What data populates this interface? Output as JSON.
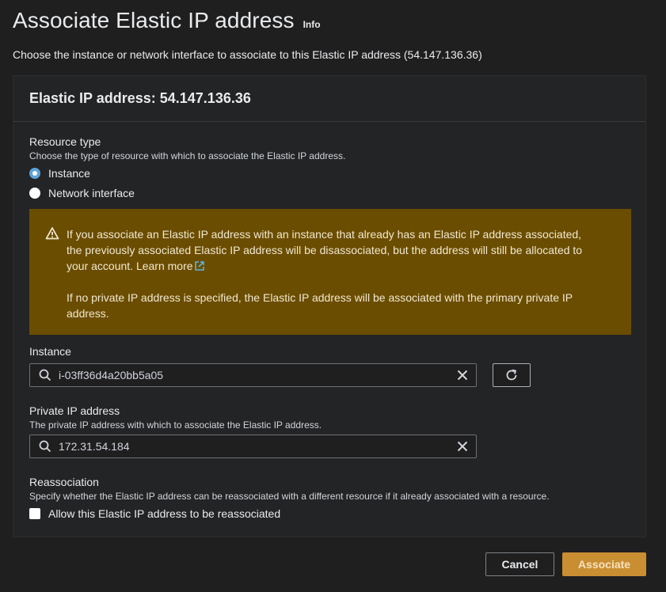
{
  "header": {
    "title": "Associate Elastic IP address",
    "info_label": "Info",
    "description": "Choose the instance or network interface to associate to this Elastic IP address (54.147.136.36)"
  },
  "panel": {
    "title": "Elastic IP address: 54.147.136.36"
  },
  "resource_type": {
    "label": "Resource type",
    "description": "Choose the type of resource with which to associate the Elastic IP address.",
    "options": [
      {
        "label": "Instance",
        "selected": true
      },
      {
        "label": "Network interface",
        "selected": false
      }
    ]
  },
  "alert": {
    "icon": "warning-icon",
    "color": "#6b4d00",
    "paragraph1": "If you associate an Elastic IP address with an instance that already has an Elastic IP address associated, the previously associated Elastic IP address will be disassociated, but the address will still be allocated to your account.",
    "learn_more": "Learn more",
    "paragraph2": "If no private IP address is specified, the Elastic IP address will be associated with the primary private IP address."
  },
  "instance": {
    "label": "Instance",
    "value": "i-03ff36d4a20bb5a05"
  },
  "private_ip": {
    "label": "Private IP address",
    "description": "The private IP address with which to associate the Elastic IP address.",
    "value": "172.31.54.184"
  },
  "reassociation": {
    "label": "Reassociation",
    "description": "Specify whether the Elastic IP address can be reassociated with a different resource if it already associated with a resource.",
    "checkbox_label": "Allow this Elastic IP address to be reassociated",
    "checked": false
  },
  "footer": {
    "cancel_label": "Cancel",
    "associate_label": "Associate",
    "accent_color": "#c98e32"
  }
}
